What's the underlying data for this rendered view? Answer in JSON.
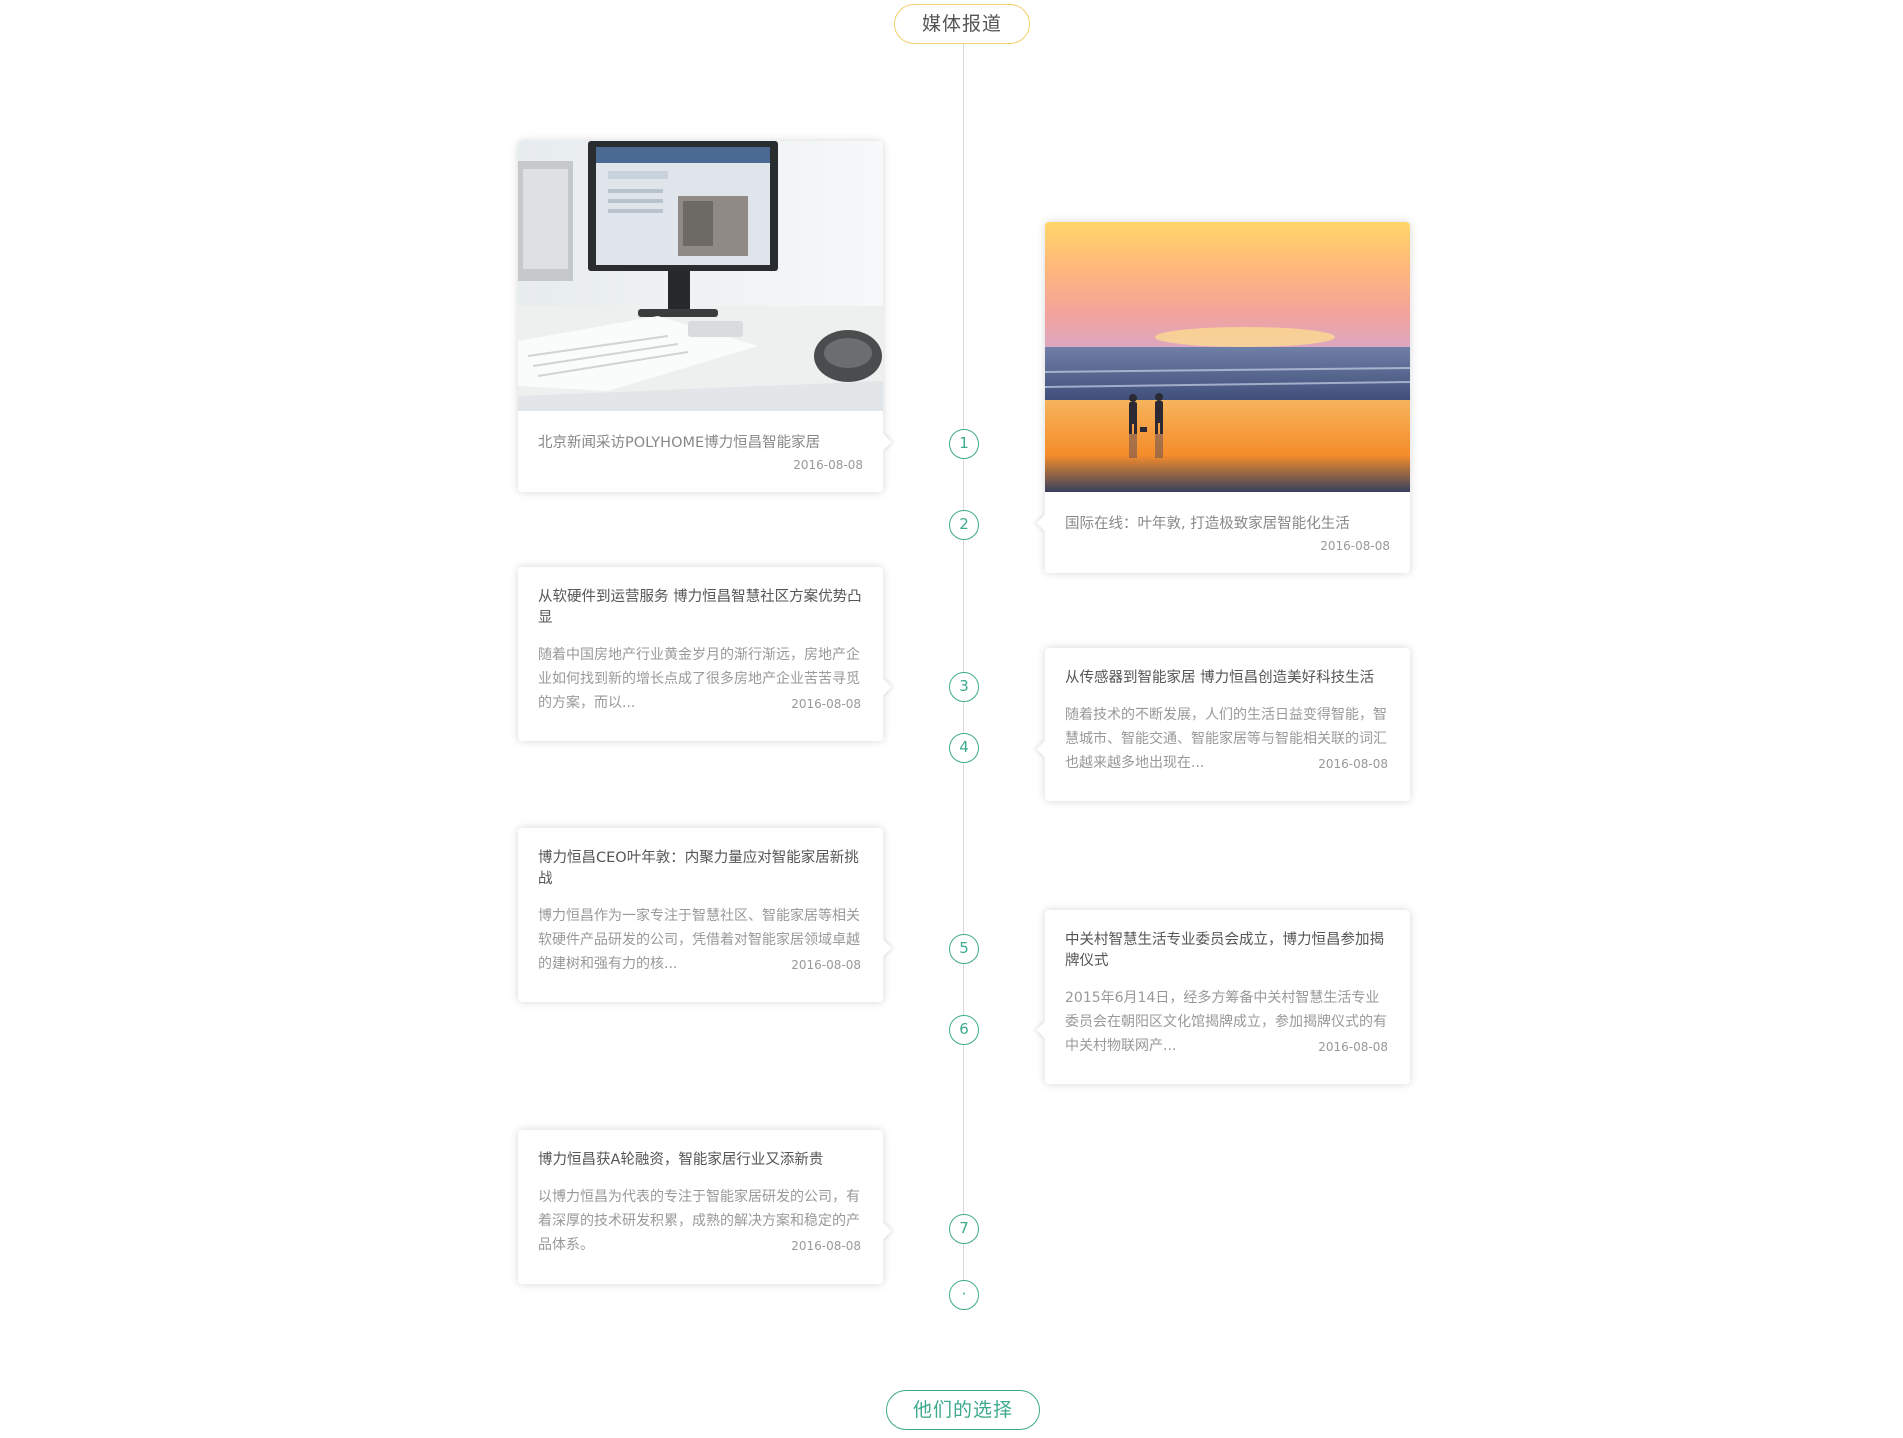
{
  "header": {
    "title": "媒体报道"
  },
  "footer": {
    "button_label": "他们的选择"
  },
  "timeline": {
    "markers": [
      "1",
      "2",
      "3",
      "4",
      "5",
      "6",
      "7",
      "·"
    ]
  },
  "articles": [
    {
      "title": "北京新闻采访POLYHOME博力恒昌智能家居",
      "date": "2016-08-08",
      "image": "office-desk-monitor-photo"
    },
    {
      "title": "国际在线：叶年敦, 打造极致家居智能化生活",
      "date": "2016-08-08",
      "image": "beach-sunset-photo"
    },
    {
      "title": "从软硬件到运营服务 博力恒昌智慧社区方案优势凸显",
      "desc": "随着中国房地产行业黄金岁月的渐行渐远，房地产企业如何找到新的增长点成了很多房地产企业苦苦寻觅的方案，而以...",
      "date": "2016-08-08"
    },
    {
      "title": "从传感器到智能家居 博力恒昌创造美好科技生活",
      "desc": "随着技术的不断发展，人们的生活日益变得智能，智慧城市、智能交通、智能家居等与智能相关联的词汇也越来越多地出现在...",
      "date": "2016-08-08"
    },
    {
      "title": "博力恒昌CEO叶年敦：内聚力量应对智能家居新挑战",
      "desc": "博力恒昌作为一家专注于智慧社区、智能家居等相关软硬件产品研发的公司，凭借着对智能家居领域卓越的建树和强有力的核...",
      "date": "2016-08-08"
    },
    {
      "title": "中关村智慧生活专业委员会成立，博力恒昌参加揭牌仪式",
      "desc": "2015年6月14日，经多方筹备中关村智慧生活专业委员会在朝阳区文化馆揭牌成立，参加揭牌仪式的有中关村物联网产...",
      "date": "2016-08-08"
    },
    {
      "title": "博力恒昌获A轮融资，智能家居行业又添新贵",
      "desc": "以博力恒昌为代表的专注于智能家居研发的公司，有着深厚的技术研发积累，成熟的解决方案和稳定的产品体系。",
      "date": "2016-08-08"
    }
  ],
  "colors": {
    "accent_green": "#3daa8c",
    "accent_yellow": "#f2cf6a"
  }
}
